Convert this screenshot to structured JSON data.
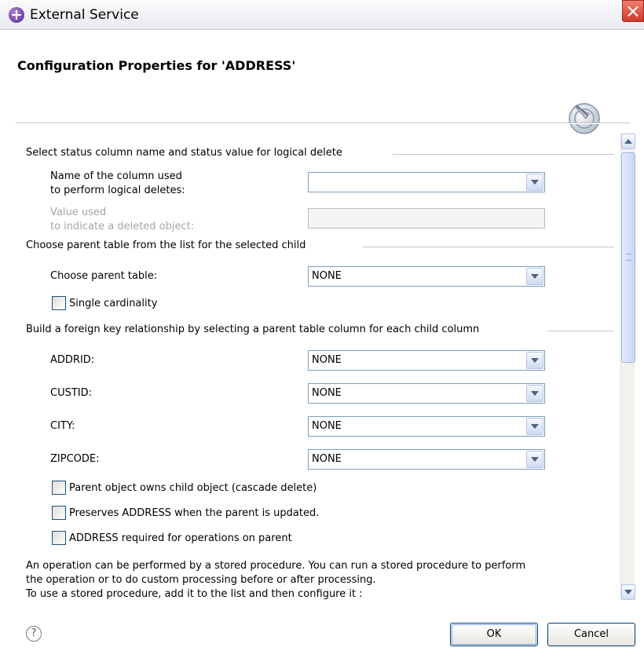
{
  "window": {
    "title": "External Service",
    "icon": "external-service-icon"
  },
  "header": {
    "title": "Configuration Properties for 'ADDRESS'",
    "icon": "wizard-banner-icon"
  },
  "logical_delete": {
    "group_label": "Select status column name and status value for logical delete",
    "column_label_1": "Name of the column used",
    "column_label_2": "to perform logical deletes:",
    "column_value": "",
    "value_label_1": "Value used",
    "value_label_2": "to indicate a deleted object:",
    "value_value": ""
  },
  "parent_table": {
    "group_label": "Choose parent table from the list for the selected child",
    "label": "Choose parent table:",
    "value": "NONE",
    "single_cardinality_label": "Single cardinality"
  },
  "foreign_key": {
    "group_label": "Build a foreign key relationship by selecting a parent table column for each child column",
    "fields": [
      {
        "label": "ADDRID:",
        "value": "NONE"
      },
      {
        "label": "CUSTID:",
        "value": "NONE"
      },
      {
        "label": "CITY:",
        "value": "NONE"
      },
      {
        "label": "ZIPCODE:",
        "value": "NONE"
      }
    ]
  },
  "options": [
    {
      "label": "Parent object owns child object (cascade delete)",
      "checked": false
    },
    {
      "label": "Preserves ADDRESS when the parent is updated.",
      "checked": false
    },
    {
      "label": "ADDRESS required for operations on parent",
      "checked": false
    }
  ],
  "stored_procedure": {
    "line1": "An operation can be performed by a stored procedure. You can run a stored procedure to perform",
    "line2": "the operation or to do custom processing before or after processing.",
    "line3": "To use a stored procedure, add it to the list and then configure it :"
  },
  "footer": {
    "help": "?",
    "ok": "OK",
    "cancel": "Cancel"
  }
}
